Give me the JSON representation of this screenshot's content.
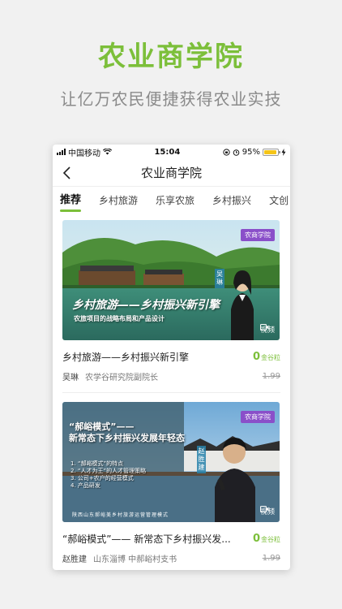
{
  "promo": {
    "title": "农业商学院",
    "subtitle": "让亿万农民便捷获得农业实技"
  },
  "status_bar": {
    "carrier": "中国移动",
    "time": "15:04",
    "battery_percent": "95%",
    "battery_level": 0.95
  },
  "nav": {
    "title": "农业商学院"
  },
  "tabs": [
    {
      "label": "推荐",
      "active": true
    },
    {
      "label": "乡村旅游"
    },
    {
      "label": "乐享农旅"
    },
    {
      "label": "乡村振兴"
    },
    {
      "label": "文创"
    }
  ],
  "courses": [
    {
      "badge": "农商学院",
      "video_label": "视频",
      "overlay_title": "乡村旅游——乡村振兴新引擎",
      "overlay_sub": "农旅项目的战略布局和产品设计",
      "name_tag": "吴琳",
      "title": "乡村旅游——乡村振兴新引擎",
      "price": "0",
      "price_unit": "金谷粒",
      "author": "吴琳",
      "desc": "农学谷研究院副院长",
      "original_price": "1.99"
    },
    {
      "badge": "农商学院",
      "video_label": "视频",
      "overlay_title_line1": "“郝峪模式”——",
      "overlay_title_line2": "新常态下乡村振兴发展年轻态",
      "overlay_points": [
        "1. “郝峪模式”的特点",
        "2. “人才为王”的人才管理策略",
        "3. 公司+农户的经营模式",
        "4. 产品研发"
      ],
      "bottom_strip": "陕西山东郝峪美乡村旅游运营管理模式",
      "name_tag": "赵胜建",
      "title": "“郝峪模式”—— 新常态下乡村振兴发...",
      "price": "0",
      "price_unit": "金谷粒",
      "author": "赵胜建",
      "desc": "山东淄博 中郝峪村支书",
      "original_price": "1.99"
    }
  ],
  "colors": {
    "accent_green": "#7cbf3a",
    "badge_purple": "#8a4fc9"
  }
}
